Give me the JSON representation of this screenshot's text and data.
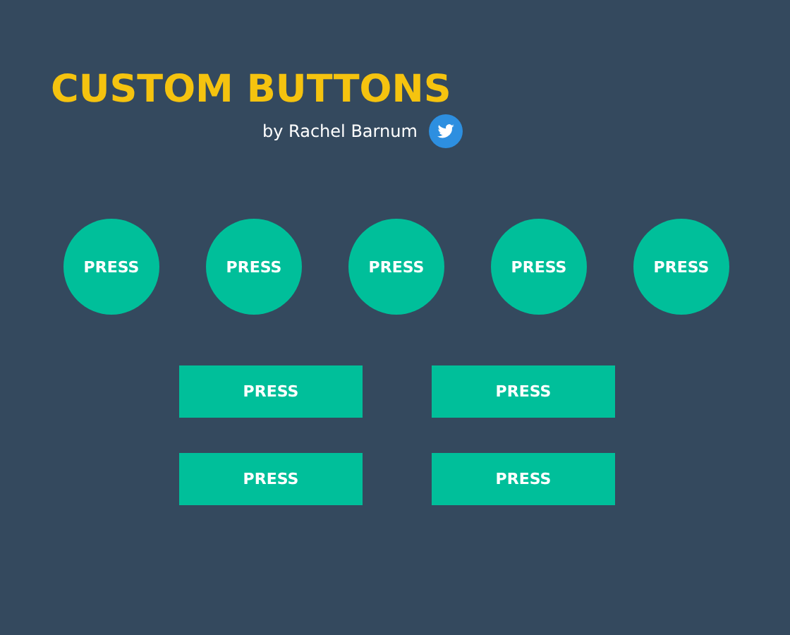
{
  "title": "CUSTOM BUTTONS",
  "byline": "by Rachel Barnum",
  "round_buttons": [
    "PRESS",
    "PRESS",
    "PRESS",
    "PRESS",
    "PRESS"
  ],
  "flat_buttons": [
    [
      "PRESS",
      "PRESS"
    ],
    [
      "PRESS",
      "PRESS"
    ]
  ]
}
